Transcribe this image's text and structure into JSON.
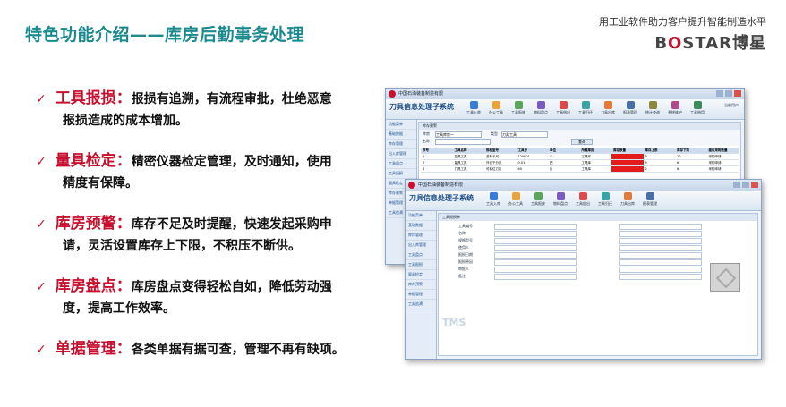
{
  "slide": {
    "title": "特色功能介绍——库房后勤事务处理",
    "slogan": "用工业软件助力客户提升智能制造水平",
    "brand": "BOSTAR博星"
  },
  "features": [
    {
      "check": "✓",
      "name": "工具报损：",
      "desc": "报损有追溯，有流程审批，杜绝恶意",
      "desc2": "报损造成的成本增加。"
    },
    {
      "check": "✓",
      "name": "量具检定：",
      "desc": "精密仪器检定管理，及时通知，使用",
      "desc2": "精度有保障。"
    },
    {
      "check": "✓",
      "name": "库房预警：",
      "desc": "库存不足及时提醒，快速发起采购申",
      "desc2": "请，灵活设置库存上下限，不积压不断供。"
    },
    {
      "check": "✓",
      "name": "库房盘点：",
      "desc": "库房盘点变得轻松自如，降低劳动强",
      "desc2": "度，提高工作效率。"
    },
    {
      "check": "✓",
      "name": "单据管理：",
      "desc": "各类单据有据可查，管理不再有缺项。",
      "desc2": ""
    }
  ],
  "screen1": {
    "window_title": "中国石油装备制造有限",
    "app_title": "刀具信息处理子系统",
    "toolbar": [
      "工具入库",
      "办公工具",
      "工具报废",
      "物料盘点",
      "工具借出",
      "工具归还",
      "刀具出库",
      "报表管理",
      "统计查询",
      "系统维护",
      "工具借用"
    ],
    "user": "当前用户",
    "tab": "库存预警",
    "sidebar": [
      "功能菜单",
      "基础数据",
      "库存管理",
      "出入库管理",
      "工具盘点",
      "工具报损",
      "量具检定",
      "库存预警",
      "单据管理",
      "工具追溯"
    ],
    "filters": {
      "warehouse_label": "库房",
      "warehouse": "工具库房一",
      "type_label": "类型",
      "type": "刀具工具",
      "name_label": "名称",
      "search": "查询"
    },
    "columns": [
      "序号",
      "工具名称",
      "规格型号",
      "工具号",
      "单位",
      "所属库房",
      "库存数量",
      "库存上限",
      "库存下限",
      "建议采购数量"
    ],
    "rows": [
      [
        "1",
        "量具工具",
        "游标卡尺",
        "120601",
        "个",
        "工具库",
        "",
        "3",
        "10",
        "采购申请"
      ],
      [
        "2",
        "量具工具",
        "外径千分尺",
        "0.01",
        "把",
        "工具库",
        "",
        "5",
        "8",
        "采购申请"
      ],
      [
        "3",
        "刀具工具",
        "可转位刀片",
        "60",
        "片",
        "工具库",
        "",
        "2",
        "6",
        "采购申请"
      ]
    ]
  },
  "screen2": {
    "window_title": "中国石油装备制造有限",
    "app_title": "刀具信息处理子系统",
    "tab": "工具报损单",
    "fields": [
      "工具编号",
      "名称",
      "规格型号",
      "使用人",
      "报损日期",
      "报损原因",
      "审批人",
      "备注"
    ],
    "watermark": "TMS"
  },
  "colors": {
    "accent": "#c8102e",
    "title": "#1b8a8f",
    "warning": "#e41b1b"
  }
}
